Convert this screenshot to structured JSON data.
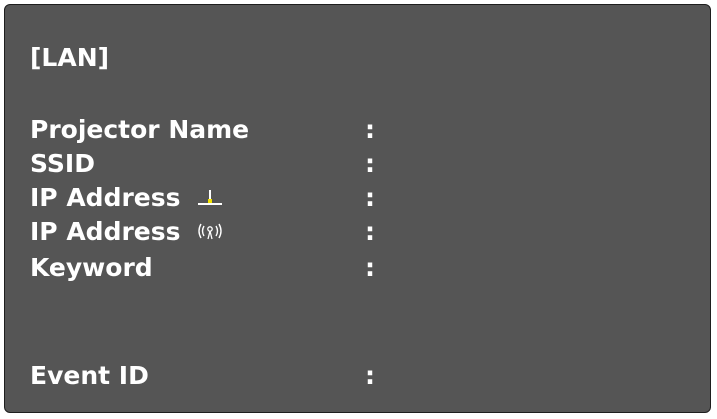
{
  "header": {
    "title": "[LAN]"
  },
  "rows": [
    {
      "label": "Projector Name",
      "separator": ":",
      "value": ""
    },
    {
      "label": "SSID",
      "separator": ":",
      "value": ""
    },
    {
      "label": "IP Address",
      "icon": "wired-lan-icon",
      "separator": ":",
      "value": ""
    },
    {
      "label": "IP Address",
      "icon": "wireless-lan-icon",
      "separator": ":",
      "value": ""
    },
    {
      "label": "Keyword",
      "separator": ":",
      "value": ""
    },
    {
      "label": "Event ID",
      "separator": ":",
      "value": ""
    }
  ],
  "colors": {
    "panel_background": "#555555",
    "text": "#ffffff",
    "icon_accent": "#f2e200"
  }
}
